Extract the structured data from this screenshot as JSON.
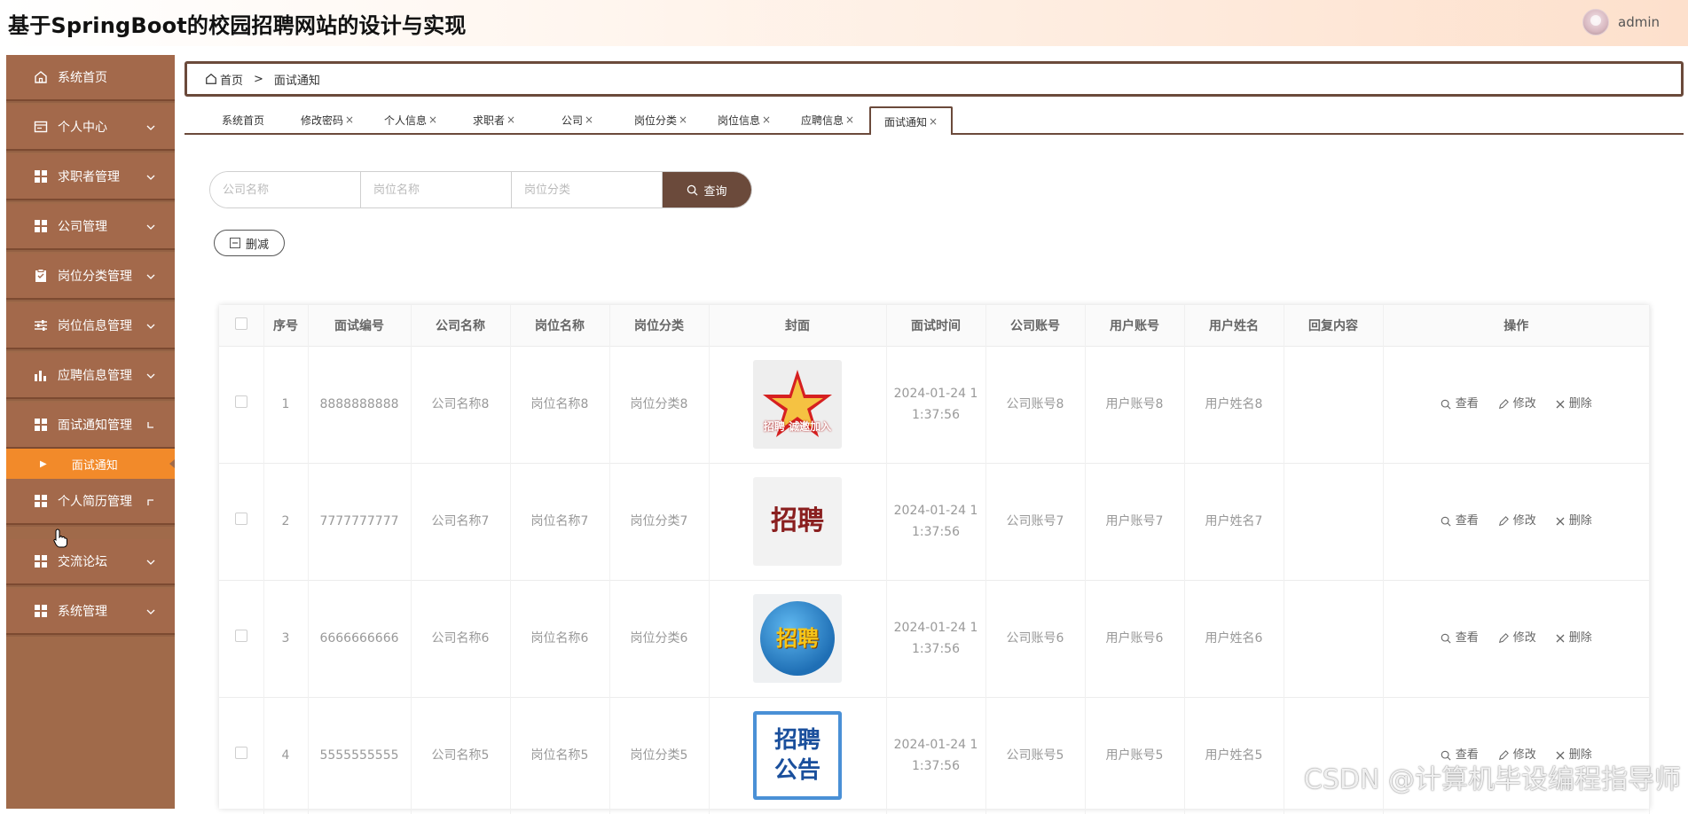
{
  "header": {
    "title": "基于SpringBoot的校园招聘网站的设计与实现",
    "username": "admin"
  },
  "sidebar": {
    "items": [
      {
        "label": "系统首页",
        "icon": "home-icon"
      },
      {
        "label": "个人中心",
        "icon": "id-card-icon"
      },
      {
        "label": "求职者管理",
        "icon": "grid-icon"
      },
      {
        "label": "公司管理",
        "icon": "grid-icon"
      },
      {
        "label": "岗位分类管理",
        "icon": "clipboard-icon"
      },
      {
        "label": "岗位信息管理",
        "icon": "sliders-icon"
      },
      {
        "label": "应聘信息管理",
        "icon": "bar-chart-icon"
      },
      {
        "label": "面试通知管理",
        "icon": "grid-icon"
      },
      {
        "label": "个人简历管理",
        "icon": "grid-icon"
      },
      {
        "label": "交流论坛",
        "icon": "grid-icon"
      },
      {
        "label": "系统管理",
        "icon": "grid-icon"
      }
    ],
    "sub_item": "面试通知"
  },
  "breadcrumb": {
    "home": "首页",
    "sep": ">",
    "current": "面试通知"
  },
  "tabs": [
    {
      "label": "系统首页",
      "close": ""
    },
    {
      "label": "修改密码",
      "close": "×"
    },
    {
      "label": "个人信息",
      "close": "×"
    },
    {
      "label": "求职者",
      "close": "×"
    },
    {
      "label": "公司",
      "close": "×"
    },
    {
      "label": "岗位分类",
      "close": "×"
    },
    {
      "label": "岗位信息",
      "close": "×"
    },
    {
      "label": "应聘信息",
      "close": "×"
    },
    {
      "label": "面试通知",
      "close": "×"
    }
  ],
  "search": {
    "company_placeholder": "公司名称",
    "position_placeholder": "岗位名称",
    "category_placeholder": "岗位分类",
    "button": "查询"
  },
  "actions": {
    "delete": "删减"
  },
  "table": {
    "columns": [
      "序号",
      "面试编号",
      "公司名称",
      "岗位名称",
      "岗位分类",
      "封面",
      "面试时间",
      "公司账号",
      "用户账号",
      "用户姓名",
      "回复内容",
      "操作"
    ],
    "rows": [
      {
        "index": "1",
        "code": "8888888888",
        "company": "公司名称8",
        "position": "岗位名称8",
        "category": "岗位分类8",
        "cover": "招聘 诚邀加入",
        "time_a": "2024-01-24 1",
        "time_b": "1:37:56",
        "company_acct": "公司账号8",
        "user_acct": "用户账号8",
        "user_name": "用户姓名8",
        "reply": ""
      },
      {
        "index": "2",
        "code": "7777777777",
        "company": "公司名称7",
        "position": "岗位名称7",
        "category": "岗位分类7",
        "cover": "招聘",
        "time_a": "2024-01-24 1",
        "time_b": "1:37:56",
        "company_acct": "公司账号7",
        "user_acct": "用户账号7",
        "user_name": "用户姓名7",
        "reply": ""
      },
      {
        "index": "3",
        "code": "6666666666",
        "company": "公司名称6",
        "position": "岗位名称6",
        "category": "岗位分类6",
        "cover": "招聘",
        "time_a": "2024-01-24 1",
        "time_b": "1:37:56",
        "company_acct": "公司账号6",
        "user_acct": "用户账号6",
        "user_name": "用户姓名6",
        "reply": ""
      },
      {
        "index": "4",
        "code": "5555555555",
        "company": "公司名称5",
        "position": "岗位名称5",
        "category": "岗位分类5",
        "cover": "招聘 公告",
        "time_a": "2024-01-24 1",
        "time_b": "1:37:56",
        "company_acct": "公司账号5",
        "user_acct": "用户账号5",
        "user_name": "用户姓名5",
        "reply": ""
      }
    ],
    "ops": {
      "view": "查看",
      "edit": "修改",
      "remove": "删除"
    }
  },
  "watermark": "CSDN @计算机毕设编程指导师",
  "colors": {
    "sidebar": "#a06a4a",
    "accent": "#6b4a3b",
    "active_sub": "#f28a2a"
  }
}
